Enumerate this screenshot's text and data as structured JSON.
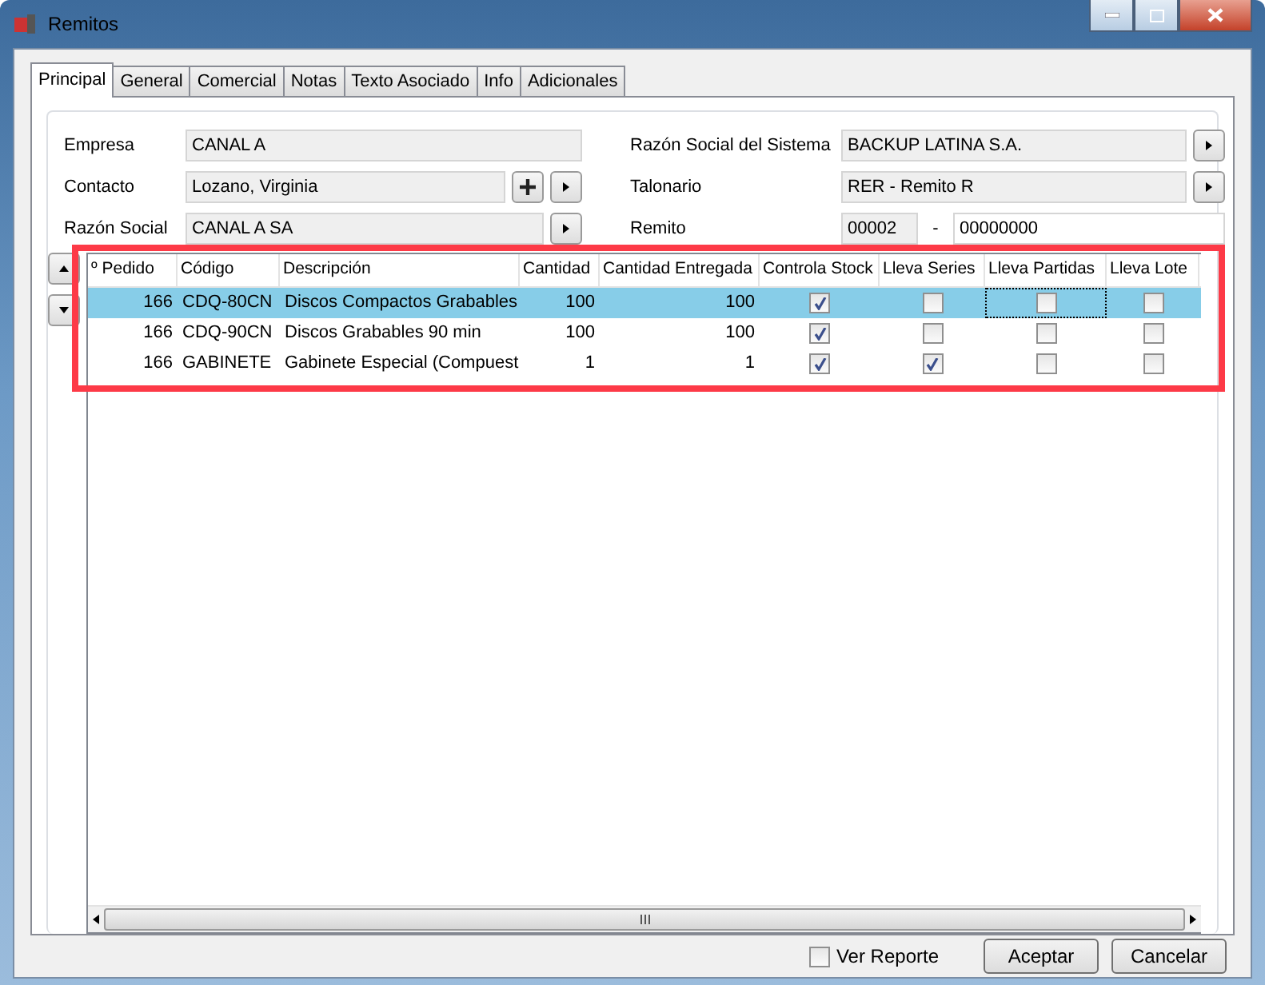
{
  "window": {
    "title": "Remitos"
  },
  "tabs": [
    {
      "label": "Principal",
      "selected": true
    },
    {
      "label": "General",
      "selected": false
    },
    {
      "label": "Comercial",
      "selected": false
    },
    {
      "label": "Notas",
      "selected": false
    },
    {
      "label": "Texto Asociado",
      "selected": false
    },
    {
      "label": "Info",
      "selected": false
    },
    {
      "label": "Adicionales",
      "selected": false
    }
  ],
  "left_fields": [
    {
      "label": "Empresa",
      "value": "CANAL A",
      "add_button": false,
      "select_button": false
    },
    {
      "label": "Contacto",
      "value": "Lozano, Virginia",
      "add_button": true,
      "select_button": true
    },
    {
      "label": "Razón Social",
      "value": "CANAL A SA",
      "add_button": false,
      "select_button": true
    }
  ],
  "right_fields": [
    {
      "label": "Razón Social del Sistema",
      "value": "BACKUP LATINA S.A.",
      "add_button": false,
      "select_button": true
    },
    {
      "label": "Talonario",
      "value": "RER - Remito R",
      "add_button": false,
      "select_button": true
    }
  ],
  "remito": {
    "label": "Remito",
    "prefix": "00002",
    "separator": "-",
    "number": "00000000"
  },
  "table": {
    "columns": [
      "º Pedido",
      "Código",
      "Descripción",
      "Cantidad",
      "Cantidad Entregada",
      "Controla Stock",
      "Lleva Series",
      "Lleva Partidas",
      "Lleva Lote"
    ],
    "rows": [
      {
        "selected": true,
        "pedido": "166",
        "codigo": "CDQ-80CN",
        "descripcion": "Discos Compactos Grabables",
        "cantidad": "100",
        "entregada": "100",
        "checks": [
          {
            "checked": true,
            "focused": false
          },
          {
            "checked": false,
            "focused": false
          },
          {
            "checked": false,
            "focused": true
          },
          {
            "checked": false,
            "focused": false
          }
        ]
      },
      {
        "selected": false,
        "pedido": "166",
        "codigo": "CDQ-90CN",
        "descripcion": "Discos Grabables 90 min",
        "cantidad": "100",
        "entregada": "100",
        "checks": [
          {
            "checked": true,
            "focused": false
          },
          {
            "checked": false,
            "focused": false
          },
          {
            "checked": false,
            "focused": false
          },
          {
            "checked": false,
            "focused": false
          }
        ]
      },
      {
        "selected": false,
        "pedido": "166",
        "codigo": "GABINETE",
        "descripcion": "Gabinete Especial (Compuest",
        "cantidad": "1",
        "entregada": "1",
        "checks": [
          {
            "checked": true,
            "focused": false
          },
          {
            "checked": true,
            "focused": false
          },
          {
            "checked": false,
            "focused": false
          },
          {
            "checked": false,
            "focused": false
          }
        ]
      }
    ]
  },
  "ver_reporte": {
    "label": "Ver Reporte",
    "checked": false
  },
  "buttons": [
    "Aceptar",
    "Cancelar"
  ]
}
